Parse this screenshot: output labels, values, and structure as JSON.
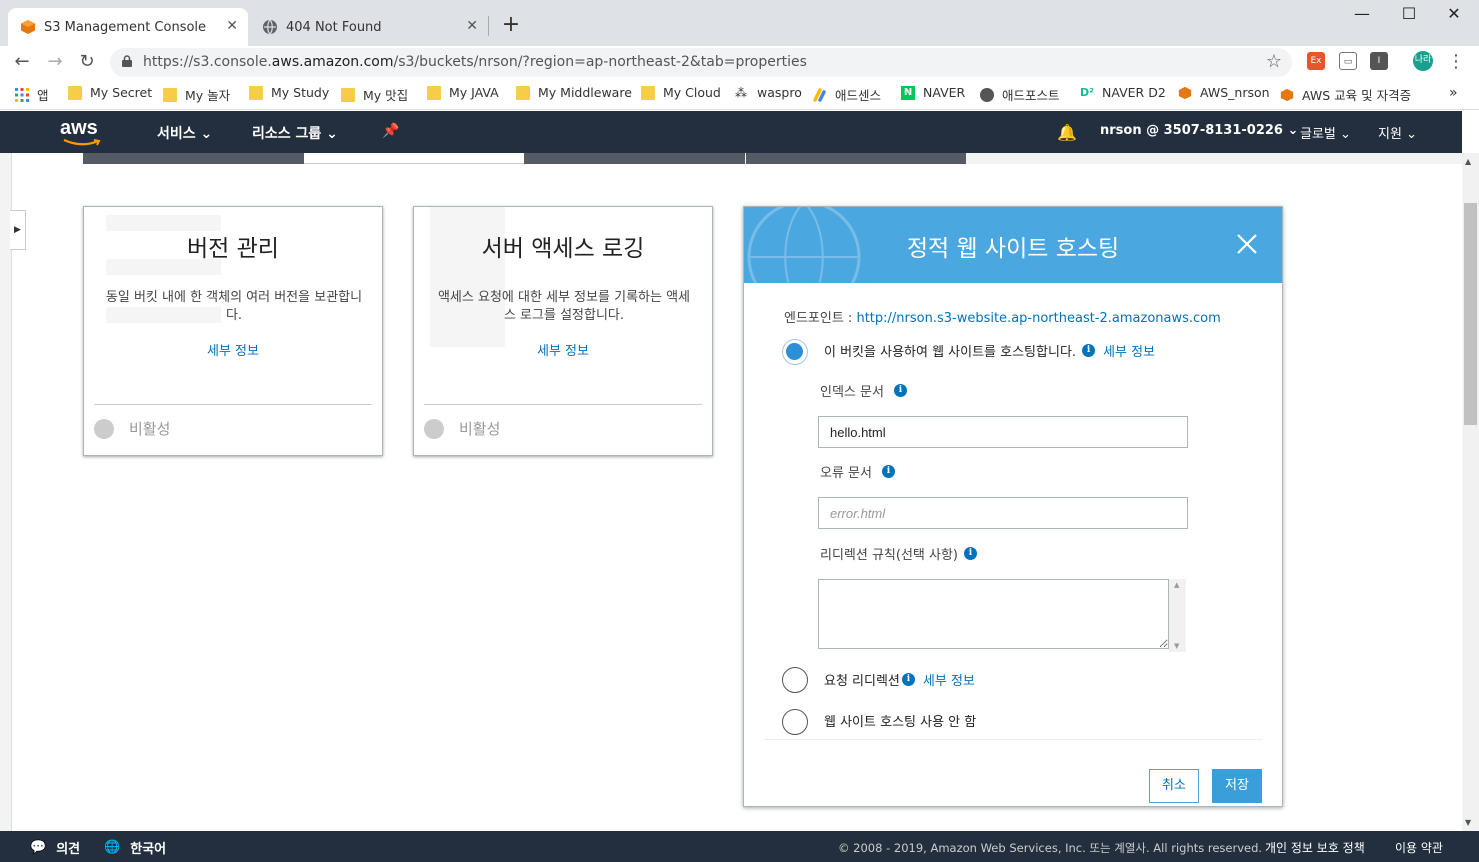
{
  "browser": {
    "tabs": [
      {
        "title": "S3 Management Console",
        "active": true
      },
      {
        "title": "404 Not Found",
        "active": false
      }
    ],
    "url_prefix": "https://s3.console.",
    "url_host": "aws.amazon.com",
    "url_path": "/s3/buckets/nrson/?region=ap-northeast-2&tab=properties",
    "bookmarks": [
      "앱",
      "My Secret",
      "My 놀자",
      "My Study",
      "My 맛집",
      "My JAVA",
      "My Middleware",
      "My Cloud",
      "waspro",
      "애드센스",
      "NAVER",
      "애드포스트",
      "NAVER D2",
      "AWS_nrson",
      "AWS 교육 및 자격증"
    ],
    "profile_initials": "나라",
    "ext_label": "Ex"
  },
  "aws_header": {
    "logo": "aws",
    "services": "서비스",
    "resource_groups": "리소스 그룹",
    "account": "nrson @ 3507-8131-0226",
    "region": "글로벌",
    "support": "지원"
  },
  "cards": [
    {
      "title": "버전 관리",
      "desc": "동일 버킷 내에 한 객체의 여러 버전을 보관합니다.",
      "more": "세부 정보",
      "status": "비활성"
    },
    {
      "title": "서버 액세스 로깅",
      "desc": "액세스 요청에 대한 세부 정보를 기록하는 액세스 로그를 설정합니다.",
      "more": "세부 정보",
      "status": "비활성"
    }
  ],
  "hosting": {
    "title": "정적 웹 사이트 호스팅",
    "endpoint_label": "엔드포인트 : ",
    "endpoint_url": "http://nrson.s3-website.ap-northeast-2.amazonaws.com",
    "option_host": "이 버킷을 사용하여 웹 사이트를 호스팅합니다.",
    "option_redirect": "요청 리디렉션",
    "option_disable": "웹 사이트 호스팅 사용 안 함",
    "more": "세부 정보",
    "index_label": "인덱스 문서",
    "index_value": "hello.html",
    "error_label": "오류 문서",
    "error_placeholder": "error.html",
    "redirect_rules_label": "리디렉션 규칙(선택 사항)",
    "cancel": "취소",
    "save": "저장",
    "selected_option": "host"
  },
  "footer": {
    "feedback": "의견",
    "language": "한국어",
    "copyright": "© 2008 - 2019, Amazon Web Services, Inc. 또는 계열사. All rights reserved.",
    "privacy": "개인 정보 보호 정책",
    "terms": "이용 약관"
  },
  "colors": {
    "aws_nav": "#232f3e",
    "panel_header": "#4aa7df",
    "link": "#0073bb",
    "radio_selected": "#2d8fd5"
  }
}
